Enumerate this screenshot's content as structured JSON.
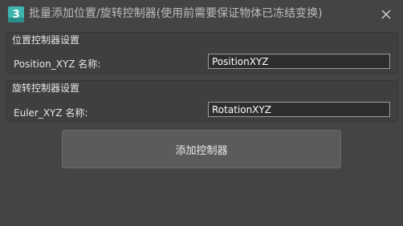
{
  "window": {
    "title": "批量添加位置/旋转控制器(使用前需要保证物体已冻结变换)",
    "app_icon": "3ds-max-icon",
    "close_icon": "close-icon"
  },
  "position_group": {
    "title": "位置控制器设置",
    "label": "Position_XYZ 名称:",
    "value": "PositionXYZ"
  },
  "rotation_group": {
    "title": "旋转控制器设置",
    "label": "Euler_XYZ 名称:",
    "value": "RotationXYZ"
  },
  "actions": {
    "add_button_label": "添加控制器"
  },
  "colors": {
    "background": "#444444",
    "group_background": "#3f3f3f",
    "input_background": "#2e2e2e",
    "button_background": "#5b5b5b",
    "icon_teal": "#3fb5b0"
  }
}
